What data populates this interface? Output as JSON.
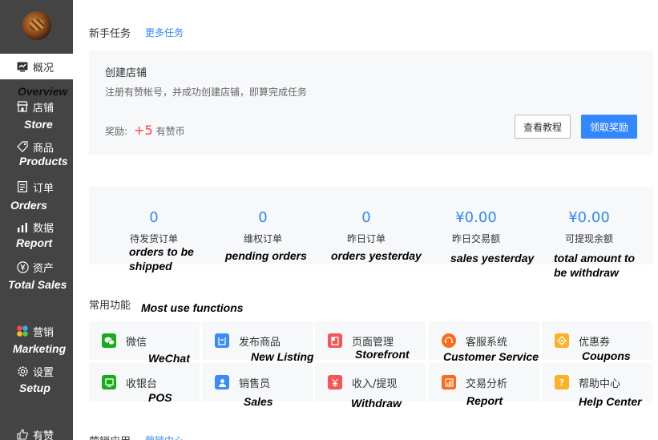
{
  "sidebar": {
    "items": [
      {
        "label": "概况",
        "en": "Overview",
        "icon": "overview-icon"
      },
      {
        "label": "店铺",
        "en": "Store",
        "icon": "store-icon"
      },
      {
        "label": "商品",
        "en": "Products",
        "icon": "tag-icon"
      },
      {
        "label": "订单",
        "en": "Orders",
        "icon": "orders-icon"
      },
      {
        "label": "数据",
        "en": "Report",
        "icon": "chart-icon"
      },
      {
        "label": "资产",
        "en": "Total Sales",
        "icon": "yen-icon"
      },
      {
        "label": "营销",
        "en": "Marketing",
        "icon": "marketing-icon"
      },
      {
        "label": "设置",
        "en": "Setup",
        "icon": "gear-icon"
      },
      {
        "label": "有赞",
        "icon": "thumbs-up-icon"
      }
    ]
  },
  "newbie": {
    "title": "新手任务",
    "more": "更多任务",
    "task_title": "创建店铺",
    "task_desc": "注册有赞帐号，并成功创建店铺，即算完成任务",
    "reward_label": "奖励:",
    "reward_value": "+5",
    "reward_unit": "有赞币",
    "btn_tutorial": "查看教程",
    "btn_claim": "领取奖励"
  },
  "stats": [
    {
      "value": "0",
      "label": "待发货订单",
      "en": "orders to be shipped"
    },
    {
      "value": "0",
      "label": "维权订单",
      "en": "pending orders"
    },
    {
      "value": "0",
      "label": "昨日订单",
      "en": "orders yesterday"
    },
    {
      "value": "¥0.00",
      "label": "昨日交易额",
      "en": "sales yesterday"
    },
    {
      "value": "¥0.00",
      "label": "可提现余额",
      "en": "total amount to be withdraw"
    }
  ],
  "functions": {
    "title": "常用功能",
    "title_en": "Most use functions",
    "items": [
      {
        "label": "微信",
        "en": "WeChat",
        "icon": "wechat-icon",
        "color": "#1aad19"
      },
      {
        "label": "发布商品",
        "en": "New Listing",
        "icon": "publish-icon",
        "color": "#3b8cf7"
      },
      {
        "label": "页面管理",
        "en": "Storefront",
        "icon": "page-icon",
        "color": "#f45656"
      },
      {
        "label": "客服系统",
        "en": "Customer Service",
        "icon": "service-icon",
        "color": "#ff6a1a"
      },
      {
        "label": "优惠券",
        "en": "Coupons",
        "icon": "coupon-icon",
        "color": "#ffb022"
      },
      {
        "label": "收银台",
        "en": "POS",
        "icon": "cashier-icon",
        "color": "#1aad19"
      },
      {
        "label": "销售员",
        "en": "Sales",
        "icon": "salesman-icon",
        "color": "#3b8cf7"
      },
      {
        "label": "收入/提现",
        "en": "Withdraw",
        "icon": "income-icon",
        "color": "#f45656"
      },
      {
        "label": "交易分析",
        "en": "Report",
        "icon": "analysis-icon",
        "color": "#ff6a1a"
      },
      {
        "label": "帮助中心",
        "en": "Help Center",
        "icon": "help-icon",
        "color": "#ffb022"
      }
    ]
  },
  "marketing": {
    "title": "营销应用",
    "more": "营销中心"
  }
}
